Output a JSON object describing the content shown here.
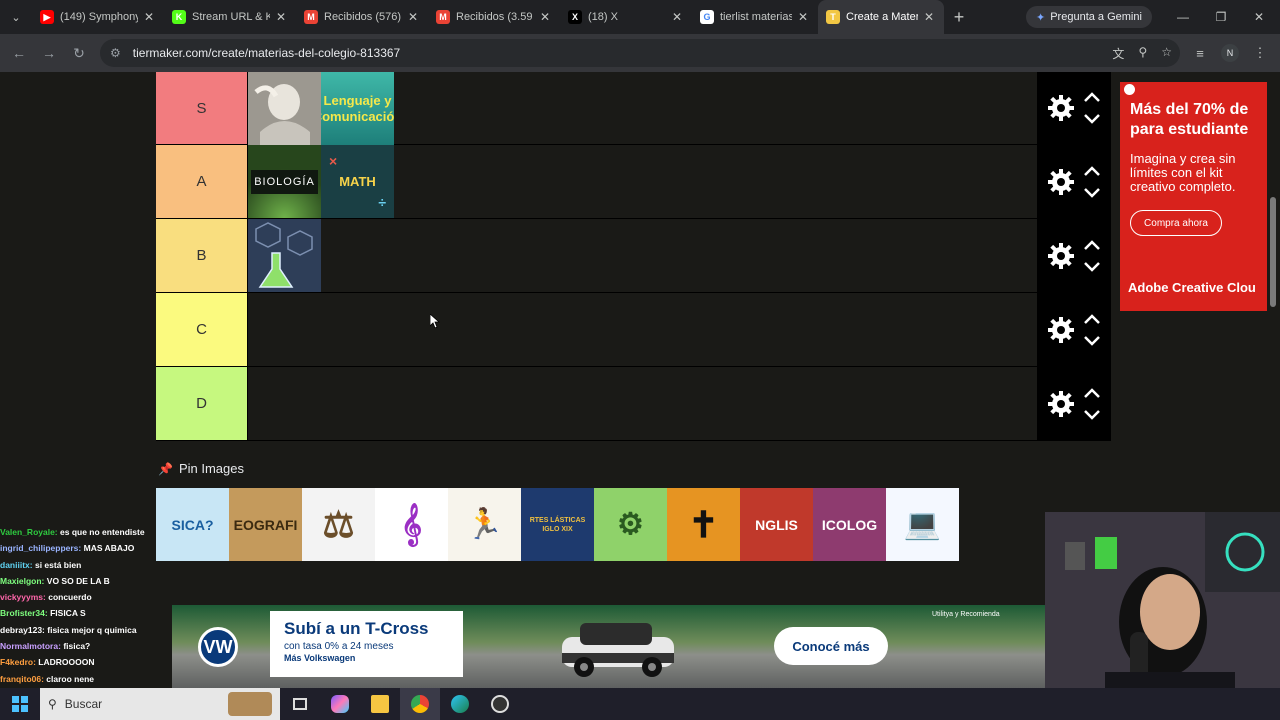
{
  "browser": {
    "tabs": [
      {
        "title": "(149) Symphony",
        "favicon": "youtube-icon",
        "color": "#ff0000",
        "glyph": "▶"
      },
      {
        "title": "Stream URL & K",
        "favicon": "kick-icon",
        "color": "#53fc18",
        "glyph": "K"
      },
      {
        "title": "Recibidos (576)",
        "favicon": "gmail-icon",
        "color": "#ea4335",
        "glyph": "M"
      },
      {
        "title": "Recibidos (3.59",
        "favicon": "gmail-icon",
        "color": "#ea4335",
        "glyph": "M"
      },
      {
        "title": "(18) X",
        "favicon": "x-icon",
        "color": "#000000",
        "glyph": "X"
      },
      {
        "title": "tierlist materias",
        "favicon": "google-icon",
        "color": "#ffffff",
        "glyph": "G"
      },
      {
        "title": "Create a Materi",
        "favicon": "tiermaker-icon",
        "color": "#f2c744",
        "glyph": "T"
      }
    ],
    "gemini_label": "Pregunta a Gemini",
    "url": "tiermaker.com/create/materias-del-colegio-813367",
    "profile_initial": "N"
  },
  "tiers": [
    {
      "label": "S",
      "color": "#f27c7f",
      "items": [
        "statue-image",
        "lenguaje-y-comunicacion-image"
      ]
    },
    {
      "label": "A",
      "color": "#f9bf7f",
      "items": [
        "biologia-image",
        "math-image"
      ]
    },
    {
      "label": "B",
      "color": "#f9de7f",
      "items": [
        "chemistry-image"
      ]
    },
    {
      "label": "C",
      "color": "#fbfa7f",
      "items": []
    },
    {
      "label": "D",
      "color": "#c6f87f",
      "items": []
    }
  ],
  "tile_texts": {
    "lenguaje": "Lenguaje y Comunicación",
    "biologia": "BIOLOGÍA",
    "math": "MATH"
  },
  "pin": {
    "title": "Pin Images",
    "images": [
      {
        "name": "fisica-image",
        "text": "SICA?",
        "bg": "#c8e6f5",
        "fg": "#1a5fa0"
      },
      {
        "name": "geografia-image",
        "text": "EOGRAFI",
        "bg": "#c49a5c",
        "fg": "#3b2a10"
      },
      {
        "name": "civica-image",
        "text": "⚖",
        "bg": "#f3f3f3",
        "fg": "#6b4e2a"
      },
      {
        "name": "musica-image",
        "text": "𝄞",
        "bg": "#ffffff",
        "fg": "#9b2fc4"
      },
      {
        "name": "educacion-fisica-image",
        "text": "🏃",
        "bg": "#f7f4ec",
        "fg": "#d87b2f"
      },
      {
        "name": "artes-plasticas-image",
        "text": "RTES LÁSTICAS IGLO XIX",
        "bg": "#1e3a6e",
        "fg": "#f0c040"
      },
      {
        "name": "tecnologia-image",
        "text": "⚙",
        "bg": "#8fd26a",
        "fg": "#2a5a20"
      },
      {
        "name": "religion-image",
        "text": "✝",
        "bg": "#e69422",
        "fg": "#111111"
      },
      {
        "name": "english-image",
        "text": "NGLIS",
        "bg": "#c0392b",
        "fg": "#ffffff"
      },
      {
        "name": "psicologia-image",
        "text": "ICOLOG",
        "bg": "#8e3b6f",
        "fg": "#ffffff"
      },
      {
        "name": "computacion-image",
        "text": "💻",
        "bg": "#f4f8ff",
        "fg": "#2e7bd6"
      }
    ]
  },
  "side_ad": {
    "headline_1": "Más del 70% de",
    "headline_2": "para estudiante",
    "body": "Imagina y crea sin límites con el kit creativo completo.",
    "button": "Compra ahora",
    "brand": "Adobe Creative Clou",
    "color": "#d8221c"
  },
  "chat": [
    {
      "user": "Valen_Royale:",
      "color": "#2ecc40",
      "msg": "es que no entendiste"
    },
    {
      "user": "ingrid_chilipeppers:",
      "color": "#9ab4ff",
      "msg": "MAS ABAJO"
    },
    {
      "user": "daniiitx:",
      "color": "#5fd3f3",
      "msg": "si está bien"
    },
    {
      "user": "Maxielgon:",
      "color": "#7fff7f",
      "msg": "VO SO DE LA B"
    },
    {
      "user": "vickyyyms:",
      "color": "#ff66aa",
      "msg": "concuerdo"
    },
    {
      "user": "Brofister34:",
      "color": "#7fff7f",
      "msg": "FISICA S"
    },
    {
      "user": "debray123:",
      "color": "#ffffff",
      "msg": "fisica mejor q quimica"
    },
    {
      "user": "Normalmotora:",
      "color": "#c9a0ff",
      "msg": "fisica?"
    },
    {
      "user": "F4kedro:",
      "color": "#ff9f40",
      "msg": "LADROOOON"
    },
    {
      "user": "franqito06:",
      "color": "#ff9f40",
      "msg": "claroo nene"
    }
  ],
  "vw_ad": {
    "title": "Subí a un T-Cross",
    "line1": "con tasa 0% a 24 meses",
    "line2": "Más Volkswagen",
    "cta": "Conocé más",
    "mini": "Utilitya y Recomienda"
  },
  "taskbar": {
    "search_placeholder": "Buscar"
  }
}
